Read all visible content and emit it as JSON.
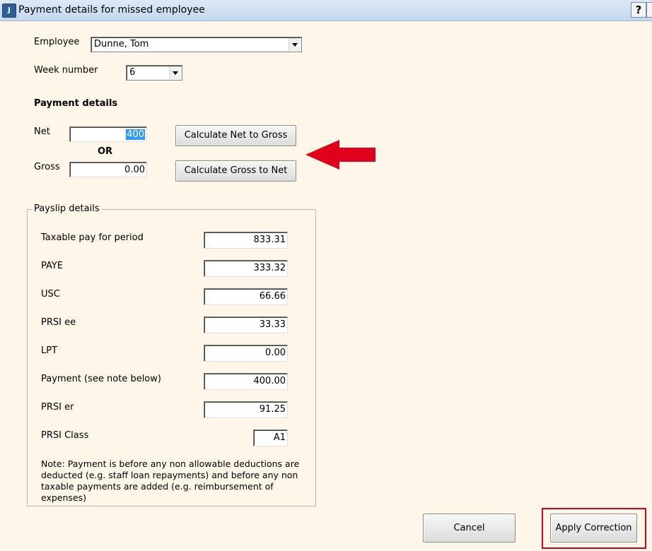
{
  "window": {
    "title": "Payment details for missed employee",
    "help_label": "?",
    "app_icon": "app-icon"
  },
  "employee": {
    "label": "Employee",
    "selected": "Dunne, Tom"
  },
  "week": {
    "label": "Week number",
    "selected": "6"
  },
  "payment_details": {
    "heading": "Payment details",
    "net_label": "Net",
    "net_value": "400",
    "or_label": "OR",
    "gross_label": "Gross",
    "gross_value": "0.00",
    "calc_net_to_gross": "Calculate Net to Gross",
    "calc_gross_to_net": "Calculate Gross to Net"
  },
  "payslip": {
    "legend": "Payslip details",
    "rows": [
      {
        "label": "Taxable pay for period",
        "value": "833.31"
      },
      {
        "label": "PAYE",
        "value": "333.32"
      },
      {
        "label": "USC",
        "value": "66.66"
      },
      {
        "label": "PRSI ee",
        "value": "33.33"
      },
      {
        "label": "LPT",
        "value": "0.00"
      },
      {
        "label": "Payment (see note below)",
        "value": "400.00"
      },
      {
        "label": "PRSI er",
        "value": "91.25"
      },
      {
        "label": "PRSI Class",
        "value": "A1"
      }
    ],
    "note_lines": [
      "Note: Payment is before any non allowable deductions are",
      "deducted (e.g. staff loan repayments) and before any non",
      "taxable payments are added (e.g. reimbursement of expenses)"
    ]
  },
  "footer": {
    "cancel_label": "Cancel",
    "apply_label": "Apply Correction"
  },
  "colors": {
    "background": "#fdf6e9",
    "annotation_red": "#e0001b"
  }
}
